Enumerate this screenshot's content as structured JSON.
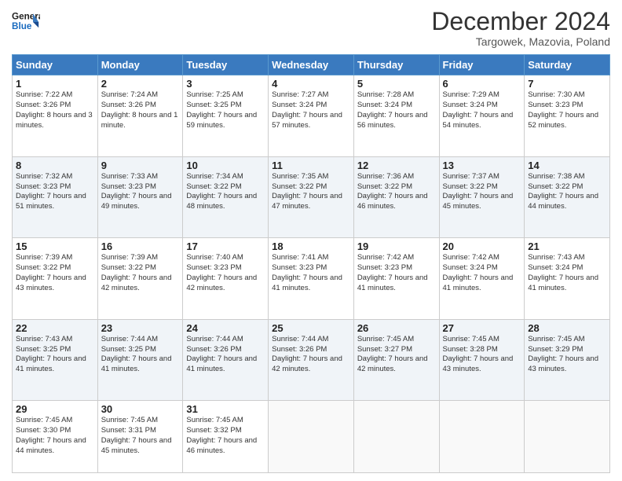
{
  "header": {
    "logo_line1": "General",
    "logo_line2": "Blue",
    "title": "December 2024",
    "subtitle": "Targowek, Mazovia, Poland"
  },
  "days_of_week": [
    "Sunday",
    "Monday",
    "Tuesday",
    "Wednesday",
    "Thursday",
    "Friday",
    "Saturday"
  ],
  "weeks": [
    [
      {
        "num": "1",
        "rise": "7:22 AM",
        "set": "3:26 PM",
        "daylight": "8 hours and 3 minutes."
      },
      {
        "num": "2",
        "rise": "7:24 AM",
        "set": "3:26 PM",
        "daylight": "8 hours and 1 minute."
      },
      {
        "num": "3",
        "rise": "7:25 AM",
        "set": "3:25 PM",
        "daylight": "7 hours and 59 minutes."
      },
      {
        "num": "4",
        "rise": "7:27 AM",
        "set": "3:24 PM",
        "daylight": "7 hours and 57 minutes."
      },
      {
        "num": "5",
        "rise": "7:28 AM",
        "set": "3:24 PM",
        "daylight": "7 hours and 56 minutes."
      },
      {
        "num": "6",
        "rise": "7:29 AM",
        "set": "3:24 PM",
        "daylight": "7 hours and 54 minutes."
      },
      {
        "num": "7",
        "rise": "7:30 AM",
        "set": "3:23 PM",
        "daylight": "7 hours and 52 minutes."
      }
    ],
    [
      {
        "num": "8",
        "rise": "7:32 AM",
        "set": "3:23 PM",
        "daylight": "7 hours and 51 minutes."
      },
      {
        "num": "9",
        "rise": "7:33 AM",
        "set": "3:23 PM",
        "daylight": "7 hours and 49 minutes."
      },
      {
        "num": "10",
        "rise": "7:34 AM",
        "set": "3:22 PM",
        "daylight": "7 hours and 48 minutes."
      },
      {
        "num": "11",
        "rise": "7:35 AM",
        "set": "3:22 PM",
        "daylight": "7 hours and 47 minutes."
      },
      {
        "num": "12",
        "rise": "7:36 AM",
        "set": "3:22 PM",
        "daylight": "7 hours and 46 minutes."
      },
      {
        "num": "13",
        "rise": "7:37 AM",
        "set": "3:22 PM",
        "daylight": "7 hours and 45 minutes."
      },
      {
        "num": "14",
        "rise": "7:38 AM",
        "set": "3:22 PM",
        "daylight": "7 hours and 44 minutes."
      }
    ],
    [
      {
        "num": "15",
        "rise": "7:39 AM",
        "set": "3:22 PM",
        "daylight": "7 hours and 43 minutes."
      },
      {
        "num": "16",
        "rise": "7:39 AM",
        "set": "3:22 PM",
        "daylight": "7 hours and 42 minutes."
      },
      {
        "num": "17",
        "rise": "7:40 AM",
        "set": "3:23 PM",
        "daylight": "7 hours and 42 minutes."
      },
      {
        "num": "18",
        "rise": "7:41 AM",
        "set": "3:23 PM",
        "daylight": "7 hours and 41 minutes."
      },
      {
        "num": "19",
        "rise": "7:42 AM",
        "set": "3:23 PM",
        "daylight": "7 hours and 41 minutes."
      },
      {
        "num": "20",
        "rise": "7:42 AM",
        "set": "3:24 PM",
        "daylight": "7 hours and 41 minutes."
      },
      {
        "num": "21",
        "rise": "7:43 AM",
        "set": "3:24 PM",
        "daylight": "7 hours and 41 minutes."
      }
    ],
    [
      {
        "num": "22",
        "rise": "7:43 AM",
        "set": "3:25 PM",
        "daylight": "7 hours and 41 minutes."
      },
      {
        "num": "23",
        "rise": "7:44 AM",
        "set": "3:25 PM",
        "daylight": "7 hours and 41 minutes."
      },
      {
        "num": "24",
        "rise": "7:44 AM",
        "set": "3:26 PM",
        "daylight": "7 hours and 41 minutes."
      },
      {
        "num": "25",
        "rise": "7:44 AM",
        "set": "3:26 PM",
        "daylight": "7 hours and 42 minutes."
      },
      {
        "num": "26",
        "rise": "7:45 AM",
        "set": "3:27 PM",
        "daylight": "7 hours and 42 minutes."
      },
      {
        "num": "27",
        "rise": "7:45 AM",
        "set": "3:28 PM",
        "daylight": "7 hours and 43 minutes."
      },
      {
        "num": "28",
        "rise": "7:45 AM",
        "set": "3:29 PM",
        "daylight": "7 hours and 43 minutes."
      }
    ],
    [
      {
        "num": "29",
        "rise": "7:45 AM",
        "set": "3:30 PM",
        "daylight": "7 hours and 44 minutes."
      },
      {
        "num": "30",
        "rise": "7:45 AM",
        "set": "3:31 PM",
        "daylight": "7 hours and 45 minutes."
      },
      {
        "num": "31",
        "rise": "7:45 AM",
        "set": "3:32 PM",
        "daylight": "7 hours and 46 minutes."
      },
      null,
      null,
      null,
      null
    ]
  ],
  "labels": {
    "sunrise": "Sunrise:",
    "sunset": "Sunset:",
    "daylight": "Daylight:"
  }
}
